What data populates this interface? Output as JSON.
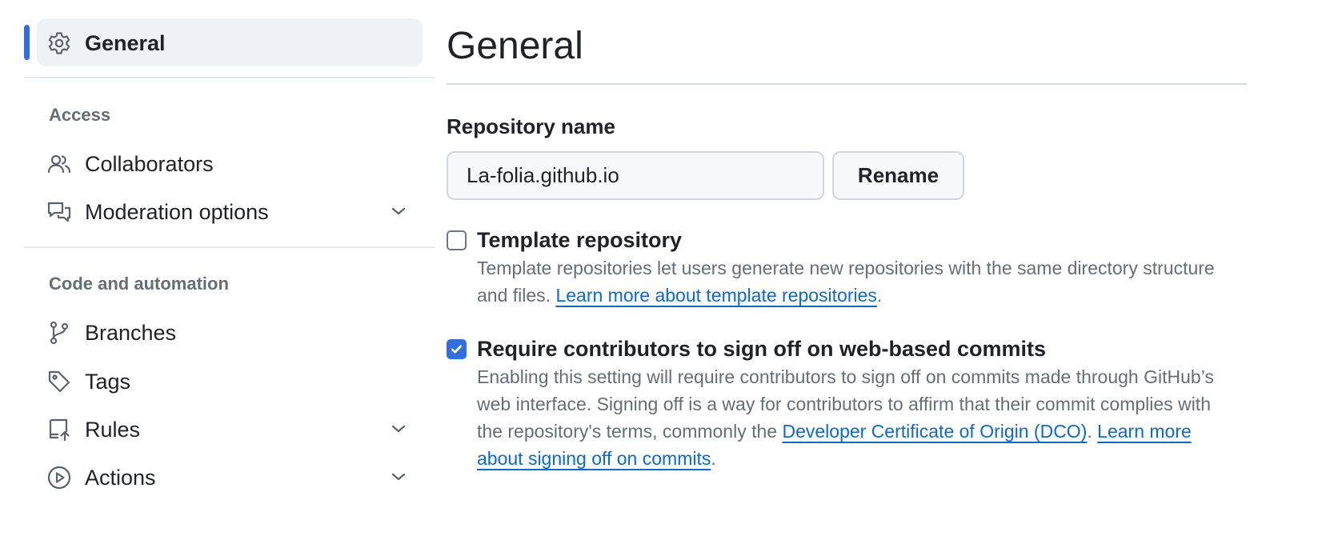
{
  "sidebar": {
    "general": {
      "label": "General",
      "icon": "gear-icon"
    },
    "access": {
      "heading": "Access",
      "items": [
        {
          "label": "Collaborators",
          "icon": "people-icon",
          "expandable": false
        },
        {
          "label": "Moderation options",
          "icon": "comment-discussion-icon",
          "expandable": true
        }
      ]
    },
    "code_and_automation": {
      "heading": "Code and automation",
      "items": [
        {
          "label": "Branches",
          "icon": "git-branch-icon",
          "expandable": false
        },
        {
          "label": "Tags",
          "icon": "tag-icon",
          "expandable": false
        },
        {
          "label": "Rules",
          "icon": "repo-push-icon",
          "expandable": true
        },
        {
          "label": "Actions",
          "icon": "play-icon",
          "expandable": true
        }
      ]
    }
  },
  "main": {
    "title": "General",
    "repo_name": {
      "label": "Repository name",
      "value": "La-folia.github.io",
      "rename_label": "Rename"
    },
    "template_option": {
      "checked": false,
      "title": "Template repository",
      "desc_text": "Template repositories let users generate new repositories with the same directory structure and files.",
      "link_text": "Learn more about template repositories",
      "after_link": "."
    },
    "signoff_option": {
      "checked": true,
      "title": "Require contributors to sign off on web-based commits",
      "desc_text": "Enabling this setting will require contributors to sign off on commits made through GitHub’s web interface. Signing off is a way for contributors to affirm that their commit complies with the repository's terms, commonly the",
      "link1_text": "Developer Certificate of Origin (DCO)",
      "between_links": ".",
      "link2_text": "Learn more about signing off on commits",
      "after_link": "."
    }
  },
  "colors": {
    "accent": "#2f6fdf",
    "link": "#0969da",
    "muted_text": "#656d76",
    "text": "#1f2328"
  }
}
